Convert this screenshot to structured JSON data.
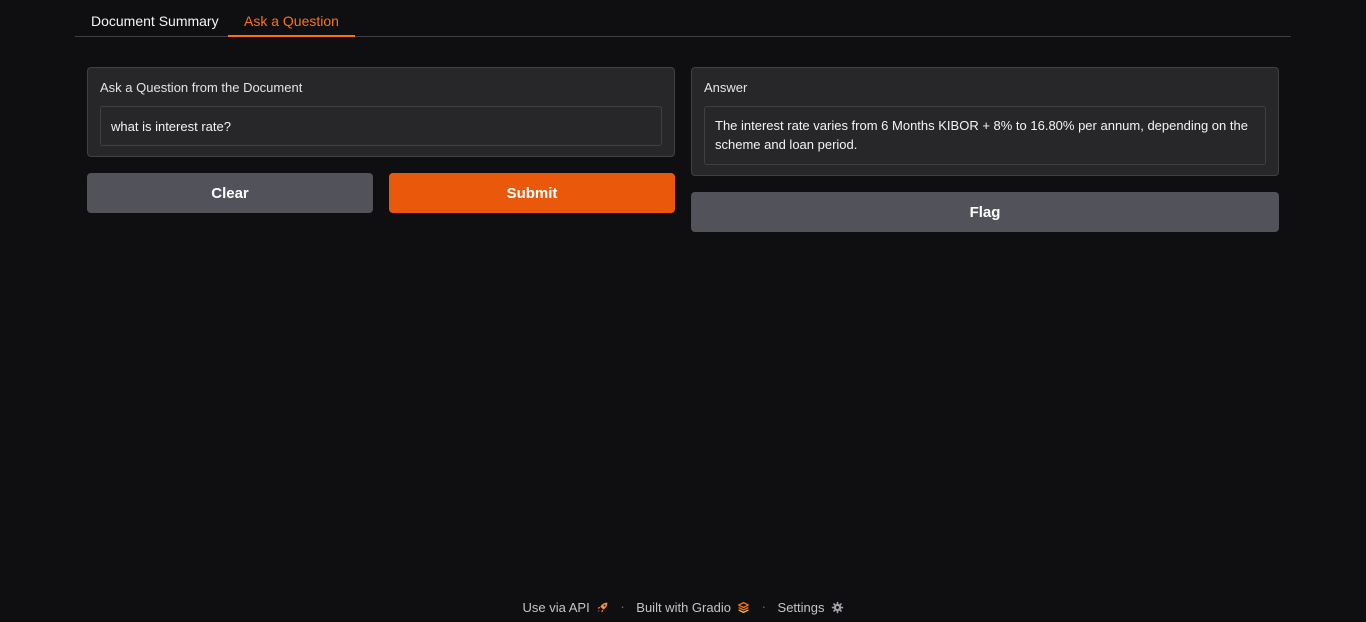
{
  "tabs": [
    {
      "label": "Document Summary",
      "active": false
    },
    {
      "label": "Ask a Question",
      "active": true
    }
  ],
  "question_panel": {
    "label": "Ask a Question from the Document",
    "value": "what is interest rate?"
  },
  "answer_panel": {
    "label": "Answer",
    "value": "The interest rate varies from 6 Months KIBOR + 8% to 16.80% per annum, depending on the scheme and loan period."
  },
  "buttons": {
    "clear": "Clear",
    "submit": "Submit",
    "flag": "Flag"
  },
  "footer": {
    "api": "Use via API",
    "built": "Built with Gradio",
    "settings": "Settings",
    "separator": "·"
  },
  "colors": {
    "background": "#0f0f11",
    "accent": "#f97316",
    "submit": "#ea580c",
    "secondary_button": "#52525b",
    "panel": "#27272a"
  },
  "icons": {
    "api": "rocket-icon",
    "built": "gradio-logo-icon",
    "settings": "gear-icon"
  }
}
